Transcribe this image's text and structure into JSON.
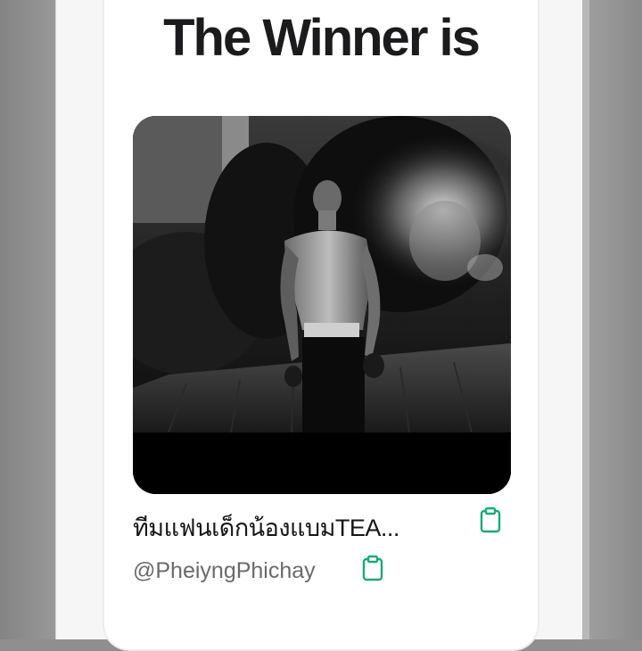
{
  "result": {
    "heading": "The Winner is",
    "winner_name": "ทีมแฟนเด็กน้องแบมTEA...",
    "winner_handle": "@PheiyngPhichay"
  },
  "photo": {
    "description_icon": "winner-photo",
    "style": "black-and-white"
  },
  "icons": {
    "copy": "clipboard-icon"
  },
  "colors": {
    "accent": "#1aa97a",
    "heading": "#1b1b1d",
    "handle": "#6a6a6a",
    "backdrop": "#8f8f8f"
  }
}
